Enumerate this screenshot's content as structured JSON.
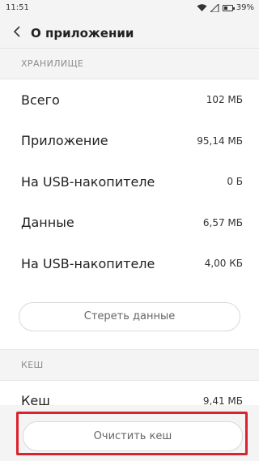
{
  "status_bar": {
    "time": "11:51",
    "battery_percent": "39%",
    "icons": [
      "wifi-icon",
      "signal-icon",
      "battery-icon"
    ]
  },
  "header": {
    "title": "О приложении",
    "back_icon": "chevron-left-icon"
  },
  "storage": {
    "section_title": "ХРАНИЛИЩЕ",
    "rows": [
      {
        "label": "Всего",
        "value": "102 МБ"
      },
      {
        "label": "Приложение",
        "value": "95,14 МБ"
      },
      {
        "label": "На USB-накопителе",
        "value": "0 Б"
      },
      {
        "label": "Данные",
        "value": "6,57 МБ"
      },
      {
        "label": "На USB-накопителе",
        "value": "4,00 КБ"
      }
    ],
    "clear_data_label": "Стереть данные"
  },
  "cache": {
    "section_title": "КЕШ",
    "rows": [
      {
        "label": "Кеш",
        "value": "9,41 МБ"
      }
    ],
    "clear_cache_label": "Очистить кеш"
  },
  "colors": {
    "highlight_border": "#d9232d",
    "background": "#f4f4f4"
  }
}
